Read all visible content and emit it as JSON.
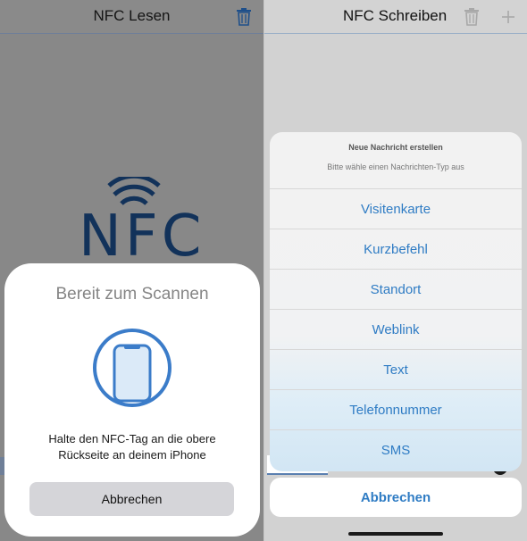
{
  "left_screen": {
    "title": "NFC Lesen",
    "logo_text": "NFC",
    "scan_sheet": {
      "title": "Bereit zum Scannen",
      "instruction_line1": "Halte den NFC-Tag an die obere",
      "instruction_line2": "Rückseite an deinem iPhone",
      "cancel_label": "Abbrechen"
    }
  },
  "right_screen": {
    "title": "NFC Schreiben",
    "action_sheet": {
      "title": "Neue Nachricht erstellen",
      "subtitle": "Bitte wähle einen Nachrichten-Typ aus",
      "options": [
        "Visitenkarte",
        "Kurzbefehl",
        "Standort",
        "Weblink",
        "Text",
        "Telefonnummer",
        "SMS"
      ],
      "cancel_label": "Abbrechen"
    }
  },
  "icons": {
    "left_nav": "trash-icon",
    "right_nav": [
      "trash-icon",
      "plus-icon"
    ],
    "logo": "nfc-waves-icon",
    "scan": "phone-icon"
  },
  "colors": {
    "accent": "#2f7cc4",
    "nfc_logo": "#12325a",
    "ring": "#3b7cc9"
  }
}
